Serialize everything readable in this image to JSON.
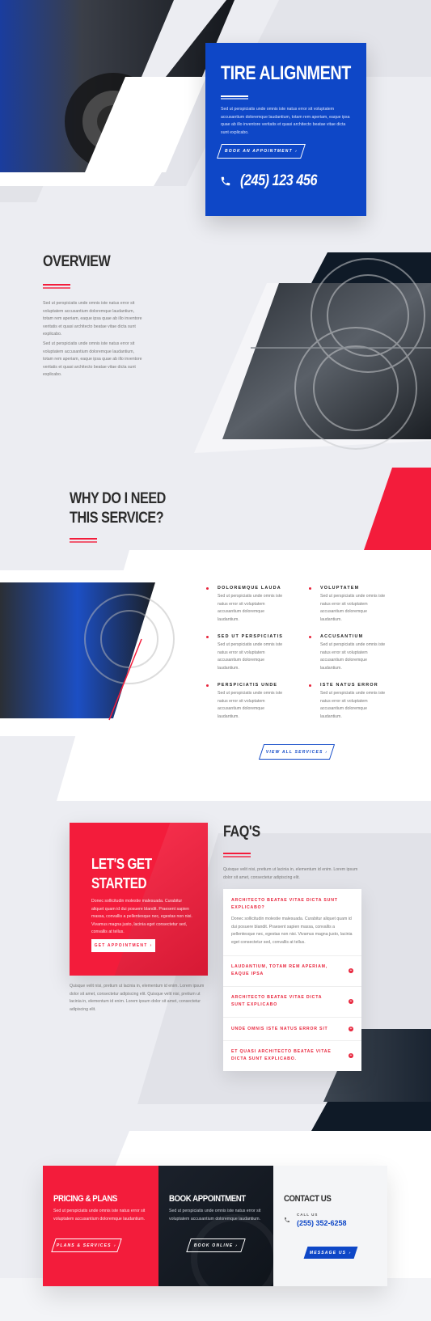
{
  "colors": {
    "blue": "#0e47c7",
    "red": "#f31c3b",
    "navy": "#0f1a27",
    "bg": "#ecedf2"
  },
  "hero": {
    "title": "TIRE ALIGNMENT",
    "text": "Sed ut perspiciatis unde omnis iste natus error sit voluptatem accusantium doloremque laudantium, totam rem aperiam, eaque ipsa quae ab illo inventore veritatis et quasi architecto beatae vitae dicta sunt explicabo.",
    "button": "BOOK AN APPOINTMENT",
    "phone": "(245) 123 456",
    "phone_icon": "phone-icon"
  },
  "overview": {
    "title": "OVERVIEW",
    "p1": "Sed ut perspiciatis unde omnis iste natus error sit voluptatem accusantium doloremque laudantium, totam rem aperiam, eaque ipsa quae ab illo inventore veritatis et quasi architecto beatae vitae dicta sunt explicabo.",
    "p2": "Sed ut perspiciatis unde omnis iste natus error sit voluptatem accusantium doloremque laudantium, totam rem aperiam, eaque ipsa quae ab illo inventore veritatis et quasi architecto beatae vitae dicta sunt explicabo."
  },
  "why": {
    "title_line1": "WHY DO I NEED",
    "title_line2": "THIS SERVICE?",
    "services": [
      {
        "title": "DOLOREMQUE LAUDA",
        "text": "Sed ut perspiciatis unde omnis iste natus error sit voluptatem accusantium doloremque laudantium."
      },
      {
        "title": "VOLUPTATEM",
        "text": "Sed ut perspiciatis unde omnis iste natus error sit voluptatem accusantium doloremque laudantium."
      },
      {
        "title": "SED UT PERSPICIATIS",
        "text": "Sed ut perspiciatis unde omnis iste natus error sit voluptatem accusantium doloremque laudantium."
      },
      {
        "title": "ACCUSANTIUM",
        "text": "Sed ut perspiciatis unde omnis iste natus error sit voluptatem accusantium doloremque laudantium."
      },
      {
        "title": "PERSPICIATIS UNDE",
        "text": "Sed ut perspiciatis unde omnis iste natus error sit voluptatem accusantium doloremque laudantium."
      },
      {
        "title": "ISTE NATUS ERROR",
        "text": "Sed ut perspiciatis unde omnis iste natus error sit voluptatem accusantium doloremque laudantium."
      }
    ],
    "button": "VIEW ALL SERVICES"
  },
  "started": {
    "title_line1": "LET'S GET",
    "title_line2": "STARTED",
    "text": "Donec sollicitudin molestie malesuada. Curabitur aliquet quam id dui posuere blandit. Praesent sapien massa, convallis a pellentesque nec, egestas non nisi. Vivamus magna justo, lacinia eget consectetur sed, convallis at tellus.",
    "button": "GET APPOINTMENT",
    "below": "Quisque velit nisi, pretium ut lacinia in, elementum id enim. Lorem ipsum dolor sit amet, consectetur adipiscing elit. Quisque velit nisi, pretium ut lacinia in, elementum id enim. Lorem ipsum dolor sit amet, consectetur adipiscing elit."
  },
  "faq": {
    "title": "FAQ'S",
    "intro": "Quisque velit nisi, pretium ut lacinia in, elementum id enim. Lorem ipsum dolor sit amet, consectetur adipiscing elit.",
    "items": [
      {
        "q": "ARCHITECTO BEATAE VITAE DICTA SUNT EXPLICABO?",
        "a": "Donec sollicitudin molestie malesuada. Curabitur aliquet quam id dui posuere blandit. Praesent sapien massa, convallis a pellentesque nec, egestas non nisi. Vivamus magna justo, lacinia eget consectetur sed, convallis at tellus."
      },
      {
        "q": "LAUDANTIUM, TOTAM REM APERIAM, EAQUE IPSA"
      },
      {
        "q": "ARCHITECTO BEATAE VITAE DICTA SUNT EXPLICABO"
      },
      {
        "q": "UNDE OMNIS ISTE NATUS ERROR SIT"
      },
      {
        "q": "ET QUASI ARCHITECTO BEATAE VITAE DICTA SUNT EXPLICABO."
      }
    ]
  },
  "cta": {
    "pricing": {
      "title": "PRICING & PLANS",
      "text": "Sed ut perspiciatis unde omnis iste natus error sit voluptatem accusantium doloremque laudantium.",
      "button": "PLANS & SERVICES"
    },
    "book": {
      "title": "BOOK APPOINTMENT",
      "text": "Sed ut perspiciatis unde omnis iste natus error sit voluptatem accusantium doloremque laudantium.",
      "button": "BOOK ONLINE"
    },
    "contact": {
      "title": "CONTACT US",
      "call_label": "CALL US",
      "phone": "(255) 352-6258",
      "button": "MESSAGE US"
    }
  }
}
